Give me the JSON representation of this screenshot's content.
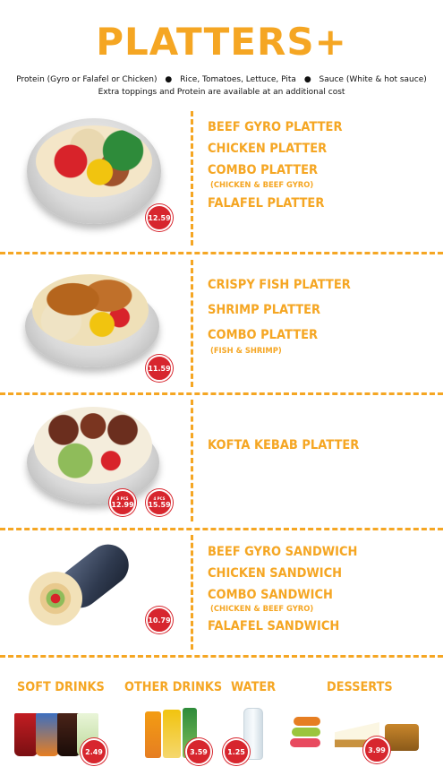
{
  "header": {
    "title": "PLATTERS+",
    "subtitle_parts": [
      "Protein (Gyro or Falafel or Chicken)",
      "Rice, Tomatoes, Lettuce, Pita",
      "Sauce (White & hot sauce)"
    ],
    "subtitle_bullet": "●",
    "subtitle2": "Extra toppings and Protein are available at an additional cost"
  },
  "sections": [
    {
      "items": [
        "BEEF GYRO PLATTER",
        "CHICKEN PLATTER",
        "COMBO PLATTER",
        "(CHICKEN & BEEF GYRO)",
        "FALAFEL PLATTER"
      ],
      "prices": [
        {
          "label": "",
          "amount": "12.59"
        }
      ]
    },
    {
      "items": [
        "CRISPY FISH PLATTER",
        "SHRIMP PLATTER",
        "COMBO PLATTER",
        "(FISH & SHRIMP)"
      ],
      "prices": [
        {
          "label": "",
          "amount": "11.59"
        }
      ]
    },
    {
      "items": [
        "KOFTA KEBAB PLATTER"
      ],
      "prices": [
        {
          "label": "3 PCS",
          "amount": "12.99"
        },
        {
          "label": "4 PCS",
          "amount": "15.59"
        }
      ]
    },
    {
      "items": [
        "BEEF GYRO SANDWICH",
        "CHICKEN SANDWICH",
        "COMBO SANDWICH",
        "(CHICKEN & BEEF GYRO)",
        "FALAFEL SANDWICH"
      ],
      "prices": [
        {
          "label": "",
          "amount": "10.79"
        }
      ]
    }
  ],
  "drinks": {
    "soft_drinks": {
      "label": "SOFT DRINKS",
      "price": "2.49"
    },
    "other_drinks": {
      "label": "OTHER DRINKS",
      "price": "3.59"
    },
    "water": {
      "label": "WATER",
      "price": "1.25"
    },
    "desserts": {
      "label": "DESSERTS",
      "price": "3.99"
    }
  },
  "colors": {
    "accent": "#f5a623",
    "price_badge": "#d7262e"
  }
}
